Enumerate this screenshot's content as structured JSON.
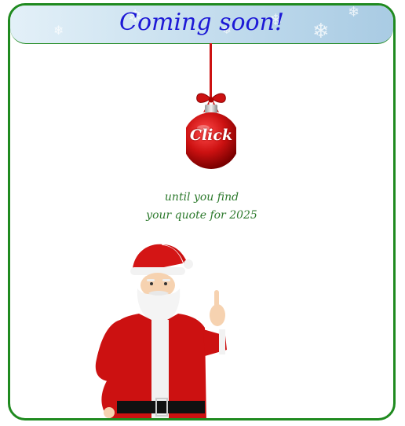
{
  "banner": {
    "title": "Coming soon!"
  },
  "ornament": {
    "label": "Click"
  },
  "tagline": {
    "line1": "until you find",
    "line2": "your quote for 2025"
  },
  "colors": {
    "frame_border": "#1f8a1f",
    "title": "#1d19d6",
    "tagline": "#2d7a2d",
    "ornament": "#cc1111"
  },
  "icons": {
    "banner_decoration": "snowflake-icon",
    "ornament": "christmas-ornament-icon",
    "illustration": "santa-claus-illustration"
  }
}
